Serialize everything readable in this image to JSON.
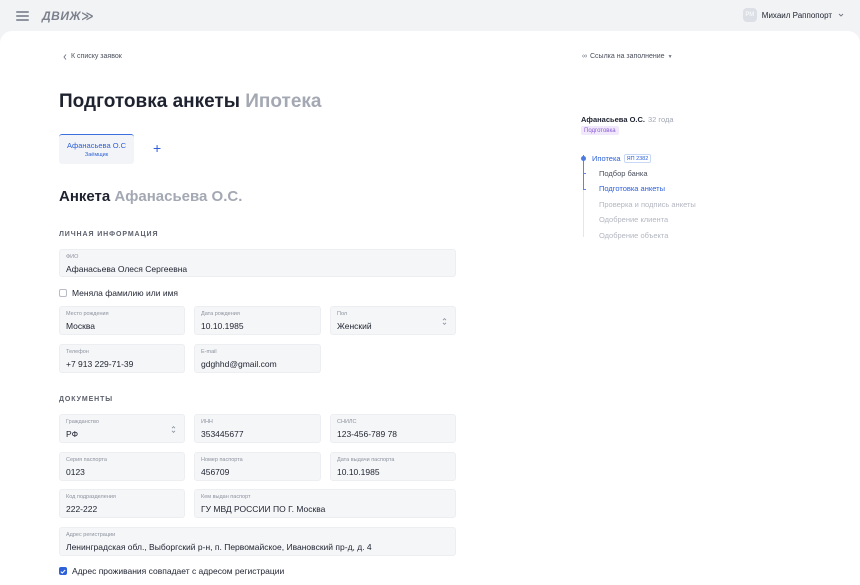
{
  "header": {
    "logo": "ДВИЖ≫",
    "user_initials": "РМ",
    "user_name": "Михаил Раппопорт"
  },
  "nav": {
    "back_label": "К списку заявок",
    "fill_link_icon": "∞",
    "fill_link_label": "Ссылка на заполнение"
  },
  "page": {
    "title": "Подготовка анкеты",
    "title_muted": "Ипотека"
  },
  "person_tab": {
    "name": "Афанасьева О.С",
    "role": "Заёмщик",
    "add_label": "+"
  },
  "anketa": {
    "title": "Анкета",
    "title_muted": "Афанасьева О.С."
  },
  "personal": {
    "heading": "ЛИЧНАЯ ИНФОРМАЦИЯ",
    "fio": {
      "label": "ФИО",
      "value": "Афанасьева Олеся Сергеевна"
    },
    "changed_name_label": "Меняла фамилию или имя",
    "birth_place": {
      "label": "Место рождения",
      "value": "Москва"
    },
    "birth_date": {
      "label": "Дата рождения",
      "value": "10.10.1985"
    },
    "sex": {
      "label": "Пол",
      "value": "Женский"
    },
    "phone": {
      "label": "Телефон",
      "value": "+7 913 229-71-39"
    },
    "email": {
      "label": "E-mail",
      "value": "gdghhd@gmail.com"
    }
  },
  "documents": {
    "heading": "ДОКУМЕНТЫ",
    "citizenship": {
      "label": "Гражданство",
      "value": "РФ"
    },
    "inn": {
      "label": "ИНН",
      "value": "353445677"
    },
    "snils": {
      "label": "СНИЛС",
      "value": "123-456-789 78"
    },
    "passport_series": {
      "label": "Серия паспорта",
      "value": "0123"
    },
    "passport_number": {
      "label": "Номер паспорта",
      "value": "456709"
    },
    "passport_date": {
      "label": "Дата выдачи паспорта",
      "value": "10.10.1985"
    },
    "division_code": {
      "label": "Код подразделения",
      "value": "222-222"
    },
    "issued_by": {
      "label": "Кем выдан паспорт",
      "value": "ГУ МВД РОССИИ ПО Г. Москва"
    },
    "reg_address": {
      "label": "Адрес регистрации",
      "value": "Ленинградская обл., Выборгский р-н, п. Первомайское, Ивановский пр-д, д. 4"
    },
    "same_address_label": "Адрес проживания совпадает с адресом регистрации"
  },
  "side": {
    "client_name": "Афанасьева О.С.",
    "client_age": "32 года",
    "badge": "Подготовка",
    "main_step": "Ипотека",
    "main_step_number": "ЯП 2382",
    "steps": [
      {
        "label": "Подбор банка",
        "color": "#4a4f5c"
      },
      {
        "label": "Подготовка анкеты",
        "color": "#2e61d9"
      },
      {
        "label": "Проверка и подпись анкеты",
        "color": "#b3b7c0"
      },
      {
        "label": "Одобрение клиента",
        "color": "#b3b7c0"
      },
      {
        "label": "Одобрение объекта",
        "color": "#b3b7c0"
      }
    ]
  }
}
